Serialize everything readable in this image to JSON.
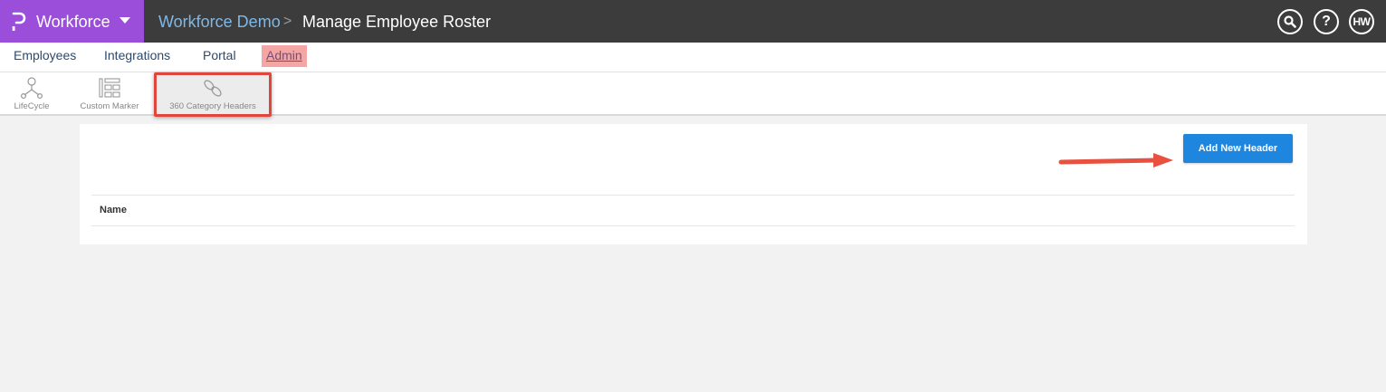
{
  "app": {
    "name": "Workforce"
  },
  "breadcrumb": {
    "org": "Workforce Demo",
    "separator": ">",
    "page": "Manage Employee Roster"
  },
  "topbar_icons": {
    "search": "search-icon",
    "help_label": "?",
    "user_initials": "HW"
  },
  "nav": {
    "items": [
      {
        "label": "Employees"
      },
      {
        "label": "Integrations"
      },
      {
        "label": "Portal"
      },
      {
        "label": "Admin"
      }
    ]
  },
  "subnav": {
    "items": [
      {
        "label": "LifeCycle",
        "icon": "lifecycle-icon"
      },
      {
        "label": "Custom Marker",
        "icon": "custom-marker-icon"
      },
      {
        "label": "360 Category Headers",
        "icon": "link-icon"
      }
    ]
  },
  "card": {
    "add_button_label": "Add New Header",
    "table": {
      "columns": [
        "Name"
      ]
    }
  },
  "colors": {
    "topbar": "#3c3c3c",
    "brand": "#9b4ed9",
    "primary_button": "#1f86e0",
    "highlight_border": "#e0463b",
    "annotation_arrow": "#e8503f"
  }
}
